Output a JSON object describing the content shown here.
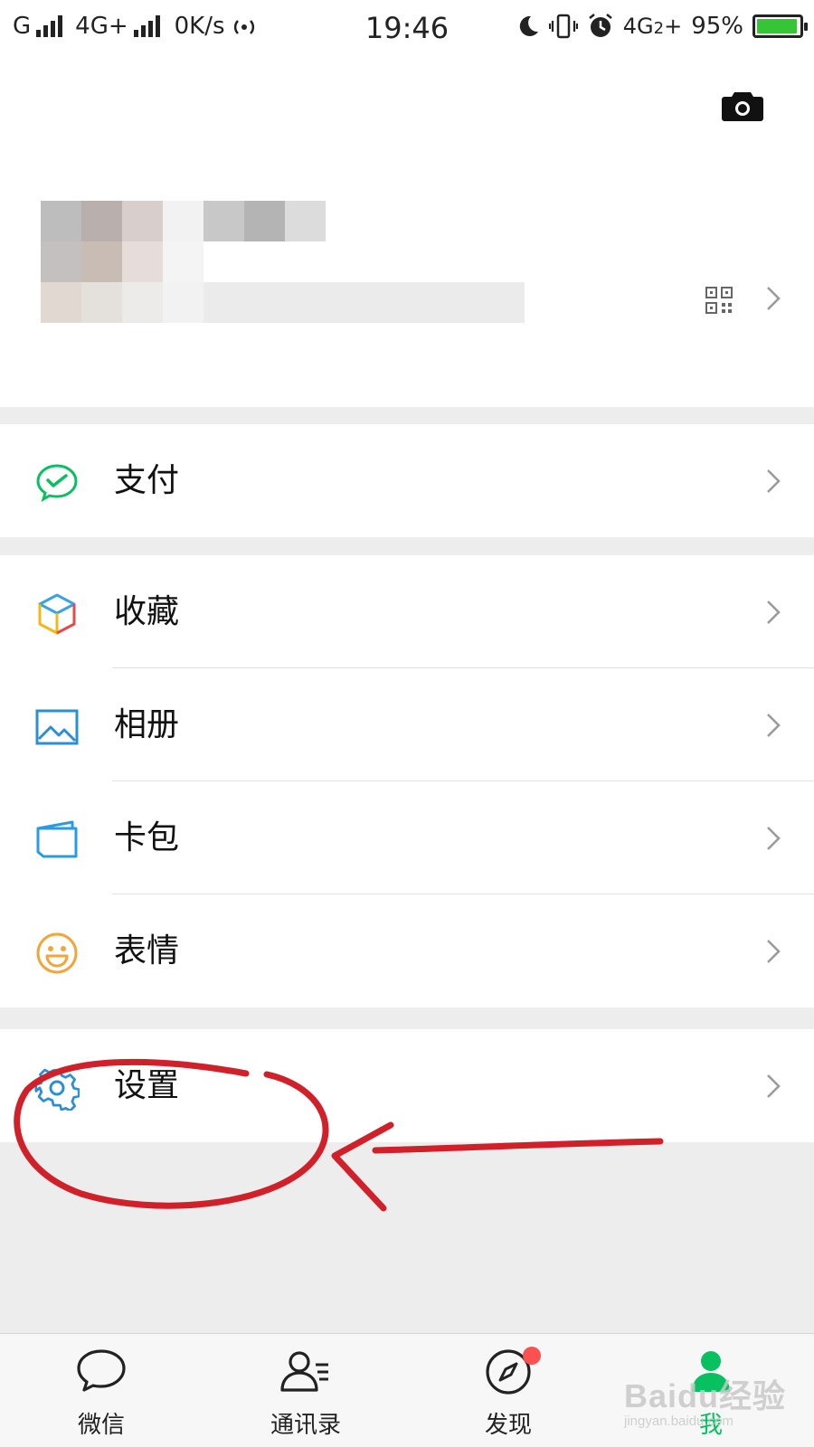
{
  "status_bar": {
    "carrier1": "G",
    "carrier2": "4G+",
    "speed": "0K/s",
    "time": "19:46",
    "network": "4G",
    "network_sub": "2",
    "network_plus": "+",
    "battery_percent": "95%",
    "battery_level": 0.95
  },
  "profile": {
    "camera_icon": "camera-icon",
    "qr_icon": "qr-code-icon"
  },
  "menu": {
    "pay": {
      "label": "支付",
      "icon": "wechat-pay-icon"
    },
    "favorites": {
      "label": "收藏",
      "icon": "cube-icon"
    },
    "album": {
      "label": "相册",
      "icon": "image-icon"
    },
    "cards": {
      "label": "卡包",
      "icon": "wallet-icon"
    },
    "stickers": {
      "label": "表情",
      "icon": "smiley-icon"
    },
    "settings": {
      "label": "设置",
      "icon": "gear-icon"
    }
  },
  "tabs": {
    "chats": "微信",
    "contacts": "通讯录",
    "discover": "发现",
    "me": "我"
  },
  "watermark": {
    "main": "Baidu经验",
    "sub": "jingyan.baidu.com"
  },
  "colors": {
    "accent": "#07c160",
    "badge": "#fa5151",
    "annotation": "#d0202a"
  }
}
